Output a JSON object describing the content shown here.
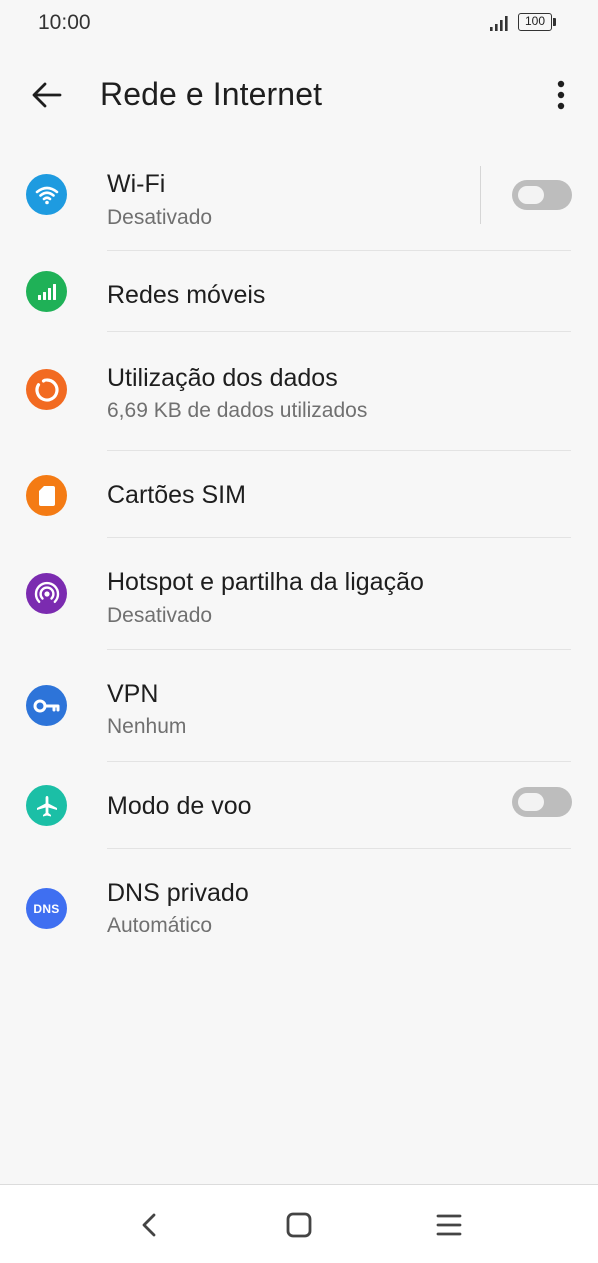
{
  "status_bar": {
    "time": "10:00",
    "battery": "100"
  },
  "header": {
    "title": "Rede e Internet"
  },
  "items": [
    {
      "title": "Wi-Fi",
      "subtitle": "Desativado",
      "icon": "wifi-icon",
      "color": "#1e9be0",
      "toggle": false
    },
    {
      "title": "Redes móveis",
      "icon": "signal-bars-icon",
      "color": "#1fb157"
    },
    {
      "title": "Utilização dos dados",
      "subtitle": "6,69 KB de dados utilizados",
      "icon": "data-usage-icon",
      "color": "#f26a21"
    },
    {
      "title": "Cartões SIM",
      "icon": "sim-card-icon",
      "color": "#f47b14"
    },
    {
      "title": "Hotspot e partilha da ligação",
      "subtitle": "Desativado",
      "icon": "hotspot-icon",
      "color": "#7b2bb0"
    },
    {
      "title": "VPN",
      "subtitle": "Nenhum",
      "icon": "vpn-key-icon",
      "color": "#2d74d9"
    },
    {
      "title": "Modo de voo",
      "icon": "airplane-icon",
      "color": "#1bbfa6",
      "toggle": false
    },
    {
      "title": "DNS privado",
      "subtitle": "Automático",
      "icon": "dns-icon",
      "icon_text": "DNS",
      "color": "#3f6ff1"
    }
  ]
}
